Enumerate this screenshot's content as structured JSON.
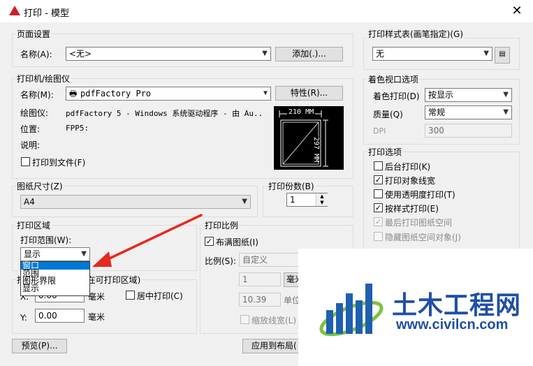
{
  "window": {
    "title": "打印 - 模型",
    "close": "✕"
  },
  "page_setup": {
    "group": "页面设置",
    "name_label": "名称(A):",
    "name_value": "<无>",
    "add_button": "添加(.)..."
  },
  "printer": {
    "group": "打印机/绘图仪",
    "name_label": "名称(M):",
    "name_value": "pdfFactory Pro",
    "properties_button": "特性(R)...",
    "plotter_label": "绘图仪:",
    "plotter_value": "pdfFactory 5 - Windows 系统驱动程序 - 由 Au...",
    "location_label": "位置:",
    "location_value": "FPP5:",
    "desc_label": "说明:",
    "print_to_file": "打印到文件(F)",
    "preview_width": "210 MM",
    "preview_height": "297 MM"
  },
  "paper_size": {
    "group": "图纸尺寸(Z)",
    "value": "A4"
  },
  "copies": {
    "group": "打印份数(B)",
    "value": "1"
  },
  "print_area": {
    "group": "打印区域",
    "range_label": "打印范围(W):",
    "range_value": "显示",
    "options": [
      "窗口",
      "范围",
      "图形界限",
      "显示"
    ],
    "selected_index": 0
  },
  "offset": {
    "group": "打印偏移(原点设置在可打印区域)",
    "x_label": "X:",
    "x_value": "0.00",
    "y_label": "Y:",
    "y_value": "0.00",
    "unit": "毫米",
    "center_label": "居中打印(C)"
  },
  "scale": {
    "group": "打印比例",
    "fit_label": "布满图纸(I)",
    "ratio_label": "比例(S):",
    "ratio_value": "自定义",
    "v1": "1",
    "unit_mm": "毫米",
    "v2": "10.39",
    "unit_label": "单位",
    "lineweight_label": "缩放线宽(L)"
  },
  "plot_style": {
    "group": "打印样式表(画笔指定)(G)",
    "value": "无"
  },
  "shaded_viewport": {
    "group": "着色视口选项",
    "shade_label": "着色打印(D)",
    "shade_value": "按显示",
    "quality_label": "质量(Q)",
    "quality_value": "常规",
    "dpi_label": "DPI",
    "dpi_value": "300"
  },
  "plot_options": {
    "group": "打印选项",
    "items": [
      {
        "label": "后台打印(K)",
        "checked": false,
        "enabled": true
      },
      {
        "label": "打印对象线宽",
        "checked": true,
        "enabled": true
      },
      {
        "label": "使用透明度打印(T)",
        "checked": false,
        "enabled": true
      },
      {
        "label": "按样式打印(E)",
        "checked": true,
        "enabled": true
      },
      {
        "label": "最后打印图纸空间",
        "checked": true,
        "enabled": false
      },
      {
        "label": "隐藏图纸空间对象(J)",
        "checked": false,
        "enabled": false
      }
    ]
  },
  "buttons": {
    "preview": "预览(P)...",
    "apply_layout": "应用到布局("
  },
  "watermark": {
    "brand": "土木工程网",
    "url": "www.civilcn.com"
  }
}
